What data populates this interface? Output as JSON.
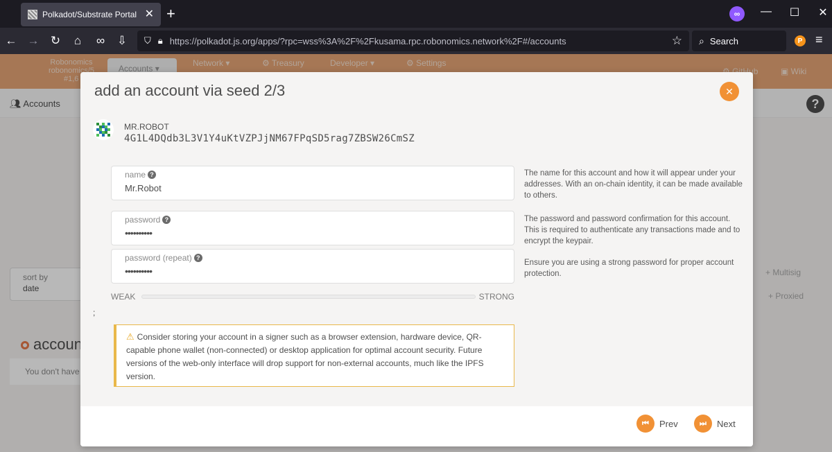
{
  "browser": {
    "tab_title": "Polkadot/Substrate Portal",
    "url": "https://polkadot.js.org/apps/?rpc=wss%3A%2F%2Fkusama.rpc.robonomics.network%2F#/accounts",
    "search_placeholder": "Search"
  },
  "app": {
    "logo_line1": "Robonomics",
    "logo_line2": "robonomics/5",
    "logo_line3": "#1,6",
    "tabs": {
      "accounts": "Accounts",
      "network": "Network",
      "treasury": "Treasury",
      "developer": "Developer",
      "settings": "Settings",
      "github": "GitHub",
      "wiki": "Wiki"
    },
    "subnav_accounts": "Accounts",
    "sort_label": "sort by",
    "sort_value": "date",
    "multisig": "Multisig",
    "proxied": "Proxied",
    "section_heading": "accoun",
    "empty_text": "You don't have"
  },
  "modal": {
    "title": "add an account via seed 2/3",
    "account_name": "MR.ROBOT",
    "account_address": "4G1L4DQdb3L3V1Y4uKtVZPJjNM67FPqSD5rag7ZBSW26CmSZ",
    "name_label": "name",
    "name_value": "Mr.Robot",
    "name_help": "The name for this account and how it will appear under your addresses. With an on-chain identity, it can be made available to others.",
    "password_label": "password",
    "password_value": "••••••••••",
    "password_help": "The password and password confirmation for this account. This is required to authenticate any transactions made and to encrypt the keypair.",
    "password_repeat_label": "password (repeat)",
    "password_repeat_value": "••••••••••",
    "password_repeat_help": "Ensure you are using a strong password for proper account protection.",
    "strength_weak": "WEAK",
    "strength_strong": "STRONG",
    "strength_level": 0,
    "semicolon": ";",
    "warning_text": "Consider storing your account in a signer such as a browser extension, hardware device, QR-capable phone wallet (non-connected) or desktop application for optimal account security. Future versions of the web-only interface will drop support for non-external accounts, much like the IPFS version.",
    "prev_label": "Prev",
    "next_label": "Next"
  }
}
